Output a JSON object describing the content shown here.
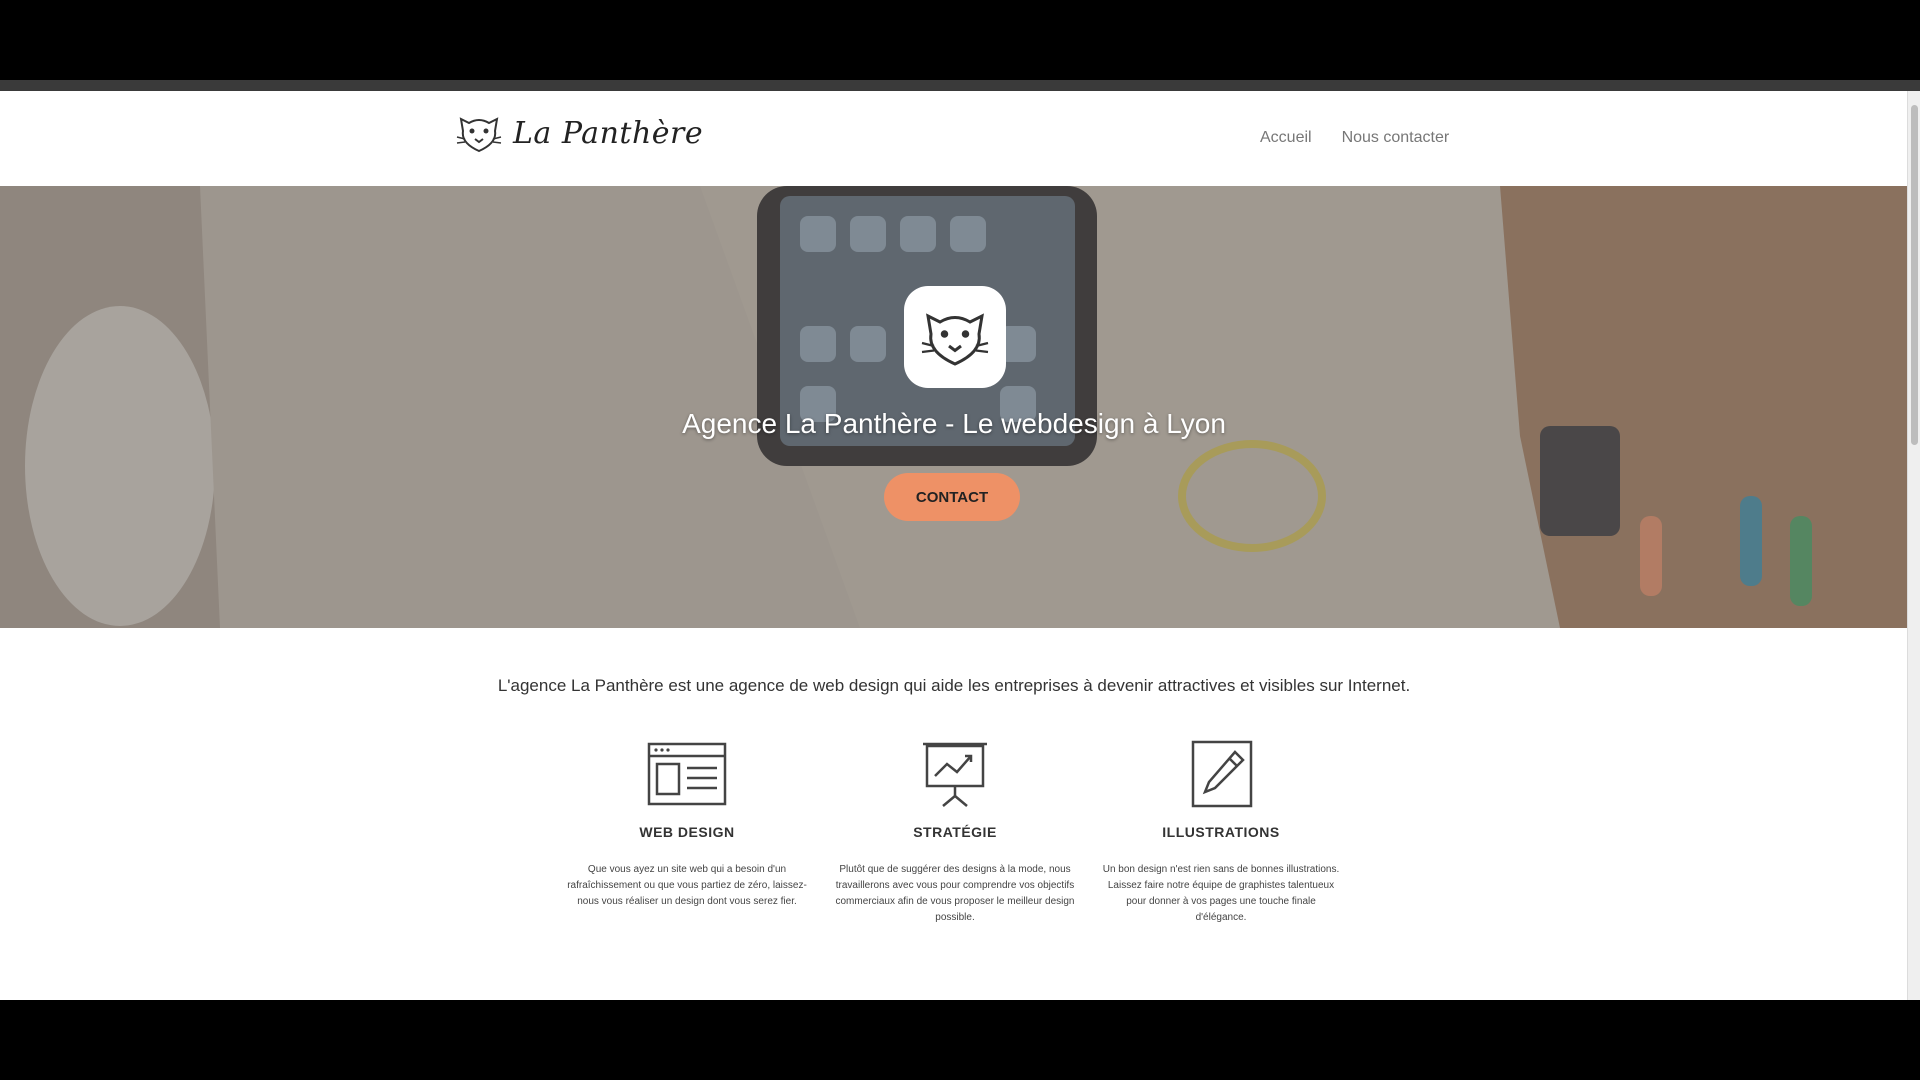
{
  "header": {
    "logo_text": "La Panthère",
    "nav": [
      "Accueil",
      "Nous contacter"
    ]
  },
  "hero": {
    "title": "Agence La Panthère - Le webdesign à Lyon",
    "cta_label": "CONTACT"
  },
  "intro": "L'agence La Panthère est une agence de web design qui aide les entreprises à devenir attractives et visibles sur Internet.",
  "services": [
    {
      "icon": "web-design-icon",
      "title": "WEB DESIGN",
      "description": "Que vous ayez un site web qui a besoin d'un rafraîchissement ou que vous partiez de zéro, laissez-nous vous réaliser un design dont vous serez fier."
    },
    {
      "icon": "strategy-icon",
      "title": "STRATÉGIE",
      "description": "Plutôt que de suggérer des designs à la mode, nous travaillerons avec vous pour comprendre vos objectifs commerciaux afin de vous proposer le meilleur design possible."
    },
    {
      "icon": "pencil-icon",
      "title": "ILLUSTRATIONS",
      "description": "Un bon design n'est rien sans de bonnes illustrations. Laissez faire notre équipe de graphistes talentueux pour donner à vos pages une touche finale d'élégance."
    }
  ],
  "colors": {
    "accent": "#ee9166",
    "hero_overlay": "#8c7f74"
  }
}
